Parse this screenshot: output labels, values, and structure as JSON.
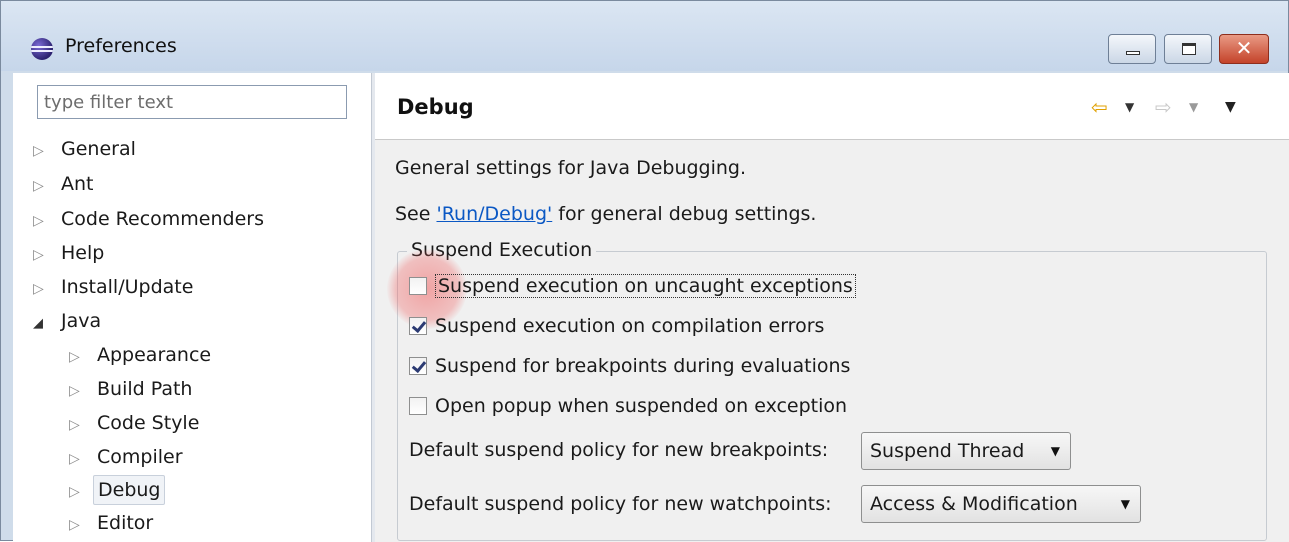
{
  "window": {
    "title": "Preferences",
    "buttons": {
      "minimize": "minimize",
      "maximize": "maximize",
      "close": "✕"
    }
  },
  "sidebar": {
    "filter_placeholder": "type filter text",
    "items": [
      {
        "label": "General",
        "expanded": false
      },
      {
        "label": "Ant",
        "expanded": false
      },
      {
        "label": "Code Recommenders",
        "expanded": false
      },
      {
        "label": "Help",
        "expanded": false
      },
      {
        "label": "Install/Update",
        "expanded": false
      },
      {
        "label": "Java",
        "expanded": true,
        "children": [
          {
            "label": "Appearance"
          },
          {
            "label": "Build Path"
          },
          {
            "label": "Code Style"
          },
          {
            "label": "Compiler"
          },
          {
            "label": "Debug",
            "selected": true
          },
          {
            "label": "Editor"
          }
        ]
      }
    ]
  },
  "page": {
    "title": "Debug",
    "description": "General settings for Java Debugging.",
    "see_prefix": "See ",
    "see_link": "'Run/Debug'",
    "see_suffix": " for general debug settings.",
    "group_title": "Suspend Execution",
    "options": [
      {
        "label": "Suspend execution on uncaught exceptions",
        "checked": false
      },
      {
        "label": "Suspend execution on compilation errors",
        "checked": true
      },
      {
        "label": "Suspend for breakpoints during evaluations",
        "checked": true
      },
      {
        "label": "Open popup when suspended on exception",
        "checked": false
      }
    ],
    "breakpoint_policy_label": "Default suspend policy for new breakpoints:",
    "breakpoint_policy_value": "Suspend Thread",
    "watchpoint_policy_label": "Default suspend policy for new watchpoints:",
    "watchpoint_policy_value": "Access & Modification"
  },
  "icons": {
    "back": "⇦",
    "back_dropdown": "▼",
    "forward": "⇨",
    "forward_dropdown": "▼",
    "view_menu": "▼",
    "tree_collapsed": "▷",
    "tree_expanded": "◢",
    "combo_dropdown": "▼"
  },
  "colors": {
    "link": "#0b58c4",
    "back_arrow": "#e0a000",
    "close_button": "#c4432a"
  }
}
